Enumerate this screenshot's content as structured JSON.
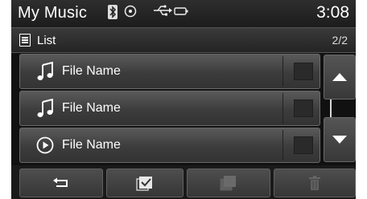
{
  "status": {
    "title": "My Music",
    "time": "3:08",
    "icons": [
      "bluetooth-icon",
      "disc-icon",
      "usb-icon",
      "battery-icon"
    ]
  },
  "header": {
    "label": "List",
    "page": "2/2"
  },
  "files": [
    {
      "name": "File Name",
      "icon": "music-note-icon",
      "checked": false
    },
    {
      "name": "File Name",
      "icon": "music-note-icon",
      "checked": false
    },
    {
      "name": "File Name",
      "icon": "play-circle-icon",
      "checked": false
    }
  ],
  "scroll": {
    "up": "scroll-up-icon",
    "down": "scroll-down-icon"
  },
  "toolbar": {
    "buttons": [
      "back-icon",
      "select-all-icon",
      "copy-icon",
      "delete-icon"
    ]
  },
  "colors": {
    "background": "#111111",
    "row": "#454545",
    "text": "#ffffff"
  }
}
